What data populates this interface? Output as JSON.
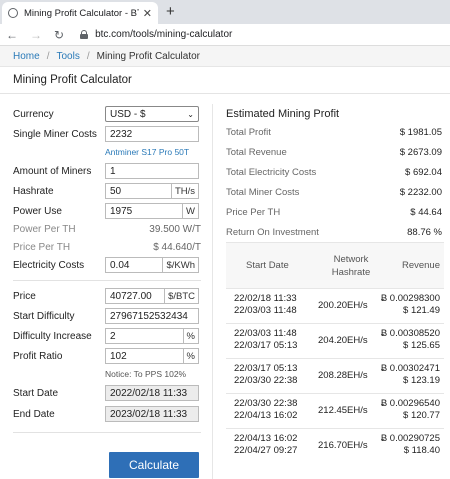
{
  "browser": {
    "tab_title": "Mining Profit Calculator - BTC.com",
    "url": "btc.com/tools/mining-calculator"
  },
  "breadcrumb": {
    "home": "Home",
    "tools": "Tools",
    "current": "Mining Profit Calculator",
    "sep": "/"
  },
  "page_title": "Mining Profit Calculator",
  "form": {
    "currency_label": "Currency",
    "currency_value": "USD - $",
    "miner_cost_label": "Single Miner Costs",
    "miner_cost_value": "2232",
    "miner_model": "Antminer S17 Pro 50T",
    "amount_label": "Amount of Miners",
    "amount_value": "1",
    "hashrate_label": "Hashrate",
    "hashrate_value": "50",
    "hashrate_unit": "TH/s",
    "power_label": "Power Use",
    "power_value": "1975",
    "power_unit": "W",
    "power_per_th_label": "Power Per TH",
    "power_per_th_value": "39.500 W/T",
    "price_per_th_label": "Price Per TH",
    "price_per_th_value": "$ 44.640/T",
    "elec_label": "Electricity Costs",
    "elec_value": "0.04",
    "elec_unit": "$/KWh",
    "price_label": "Price",
    "price_value": "40727.00",
    "price_unit": "$/BTC",
    "difficulty_label": "Start Difficulty",
    "difficulty_value": "27967152532434",
    "diff_inc_label": "Difficulty Increase",
    "diff_inc_value": "2",
    "diff_inc_unit": "%",
    "profit_ratio_label": "Profit Ratio",
    "profit_ratio_value": "102",
    "profit_ratio_unit": "%",
    "pps_note": "Notice: To PPS 102%",
    "start_date_label": "Start Date",
    "start_date_value": "2022/02/18 11:33",
    "end_date_label": "End Date",
    "end_date_value": "2023/02/18 11:33",
    "calculate_label": "Calculate"
  },
  "summary": {
    "title": "Estimated Mining Profit",
    "rows": [
      {
        "label": "Total Profit",
        "value": "$ 1981.05"
      },
      {
        "label": "Total Revenue",
        "value": "$ 2673.09"
      },
      {
        "label": "Total Electricity Costs",
        "value": "$ 692.04"
      },
      {
        "label": "Total Miner Costs",
        "value": "$ 2232.00"
      },
      {
        "label": "Price Per TH",
        "value": "$ 44.64"
      },
      {
        "label": "Return On Investment",
        "value": "88.76 %"
      }
    ]
  },
  "table": {
    "headers": {
      "start": "Start Date",
      "hashrate_1": "Network",
      "hashrate_2": "Hashrate",
      "revenue": "Revenue"
    },
    "rows": [
      {
        "d1": "22/02/18 11:33",
        "d2": "22/03/03 11:48",
        "hashrate": "200.20EH/s",
        "btc": "Ƀ 0.00298300",
        "usd": "$ 121.49"
      },
      {
        "d1": "22/03/03 11:48",
        "d2": "22/03/17 05:13",
        "hashrate": "204.20EH/s",
        "btc": "Ƀ 0.00308520",
        "usd": "$ 125.65"
      },
      {
        "d1": "22/03/17 05:13",
        "d2": "22/03/30 22:38",
        "hashrate": "208.28EH/s",
        "btc": "Ƀ 0.00302471",
        "usd": "$ 123.19"
      },
      {
        "d1": "22/03/30 22:38",
        "d2": "22/04/13 16:02",
        "hashrate": "212.45EH/s",
        "btc": "Ƀ 0.00296540",
        "usd": "$ 120.77"
      },
      {
        "d1": "22/04/13 16:02",
        "d2": "22/04/27 09:27",
        "hashrate": "216.70EH/s",
        "btc": "Ƀ 0.00290725",
        "usd": "$ 118.40"
      }
    ]
  }
}
